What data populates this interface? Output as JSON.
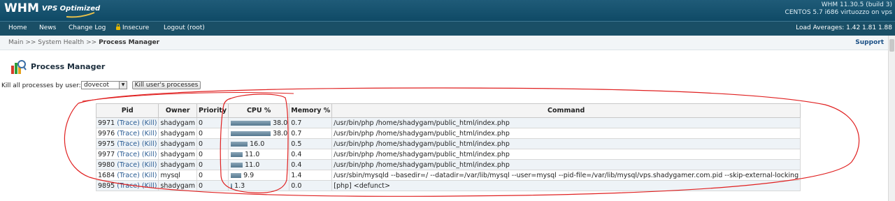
{
  "header": {
    "logo_main": "WHM",
    "logo_sub": "VPS Optimized",
    "version": "WHM 11.30.5 (build 3)",
    "os": "CENTOS 5.7 i686 virtuozzo on vps"
  },
  "nav": {
    "items": [
      "Home",
      "News",
      "Change Log",
      "Insecure",
      "Logout (root)"
    ],
    "load_averages": "Load Averages: 1.42 1.81 1.88"
  },
  "breadcrumb": {
    "path": "Main >> System Health >> ",
    "current": "Process Manager",
    "support": "Support"
  },
  "page": {
    "title": "Process Manager",
    "kill_label": "Kill all processes by user:",
    "selected_user": "dovecot",
    "kill_button": "Kill user's processes"
  },
  "table": {
    "headers": [
      "Pid",
      "Owner",
      "Priority",
      "CPU %",
      "Memory %",
      "Command"
    ],
    "trace_label": "(Trace)",
    "kill_label": "(Kill)",
    "rows": [
      {
        "pid": "9971",
        "owner": "shadygam",
        "priority": "0",
        "cpu": "38.0",
        "cpu_value": 38.0,
        "mem": "0.7",
        "cmd": "/usr/bin/php /home/shadygam/public_html/index.php"
      },
      {
        "pid": "9976",
        "owner": "shadygam",
        "priority": "0",
        "cpu": "38.0",
        "cpu_value": 38.0,
        "mem": "0.7",
        "cmd": "/usr/bin/php /home/shadygam/public_html/index.php"
      },
      {
        "pid": "9975",
        "owner": "shadygam",
        "priority": "0",
        "cpu": "16.0",
        "cpu_value": 16.0,
        "mem": "0.5",
        "cmd": "/usr/bin/php /home/shadygam/public_html/index.php"
      },
      {
        "pid": "9977",
        "owner": "shadygam",
        "priority": "0",
        "cpu": "11.0",
        "cpu_value": 11.0,
        "mem": "0.4",
        "cmd": "/usr/bin/php /home/shadygam/public_html/index.php"
      },
      {
        "pid": "9980",
        "owner": "shadygam",
        "priority": "0",
        "cpu": "11.0",
        "cpu_value": 11.0,
        "mem": "0.4",
        "cmd": "/usr/bin/php /home/shadygam/public_html/index.php"
      },
      {
        "pid": "1684",
        "owner": "mysql",
        "priority": "0",
        "cpu": "9.9",
        "cpu_value": 9.9,
        "mem": "1.4",
        "cmd": "/usr/sbin/mysqld --basedir=/ --datadir=/var/lib/mysql --user=mysql --pid-file=/var/lib/mysql/vps.shadygamer.com.pid --skip-external-locking"
      },
      {
        "pid": "9895",
        "owner": "shadygam",
        "priority": "0",
        "cpu": "1.3",
        "cpu_value": 1.3,
        "mem": "0.0",
        "cmd": "[php] <defunct>"
      }
    ]
  },
  "colors": {
    "header_bg": "#0f4a66",
    "nav_bg": "#1a4f66",
    "link": "#2a5c94",
    "cpu_bar": "#55788f",
    "annotation": "#e02020"
  }
}
